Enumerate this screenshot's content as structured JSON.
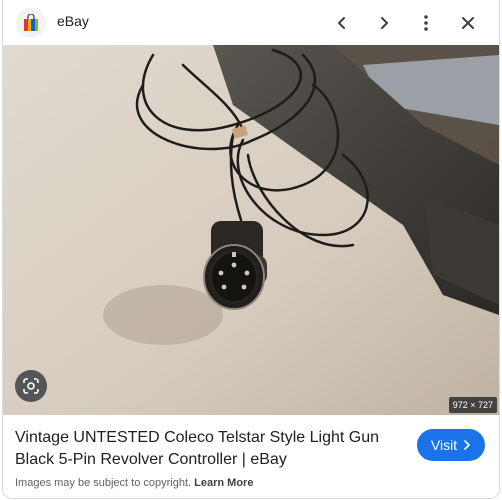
{
  "header": {
    "site_name": "eBay",
    "favicon": "ebay-bag-icon",
    "buttons": [
      "chevron-left-icon",
      "chevron-right-icon",
      "more-vert-icon",
      "close-icon"
    ]
  },
  "image": {
    "dimensions": "972 × 727",
    "lens_icon": "google-lens-icon"
  },
  "result": {
    "title": "Vintage UNTESTED Coleco Telstar Style Light Gun Black 5-Pin Revolver Controller | eBay",
    "visit_label": "Visit",
    "copyright_text": "Images may be subject to copyright.",
    "learn_more": "Learn More"
  },
  "colors": {
    "accent": "#1a73e8",
    "text_secondary": "#5f6368"
  }
}
